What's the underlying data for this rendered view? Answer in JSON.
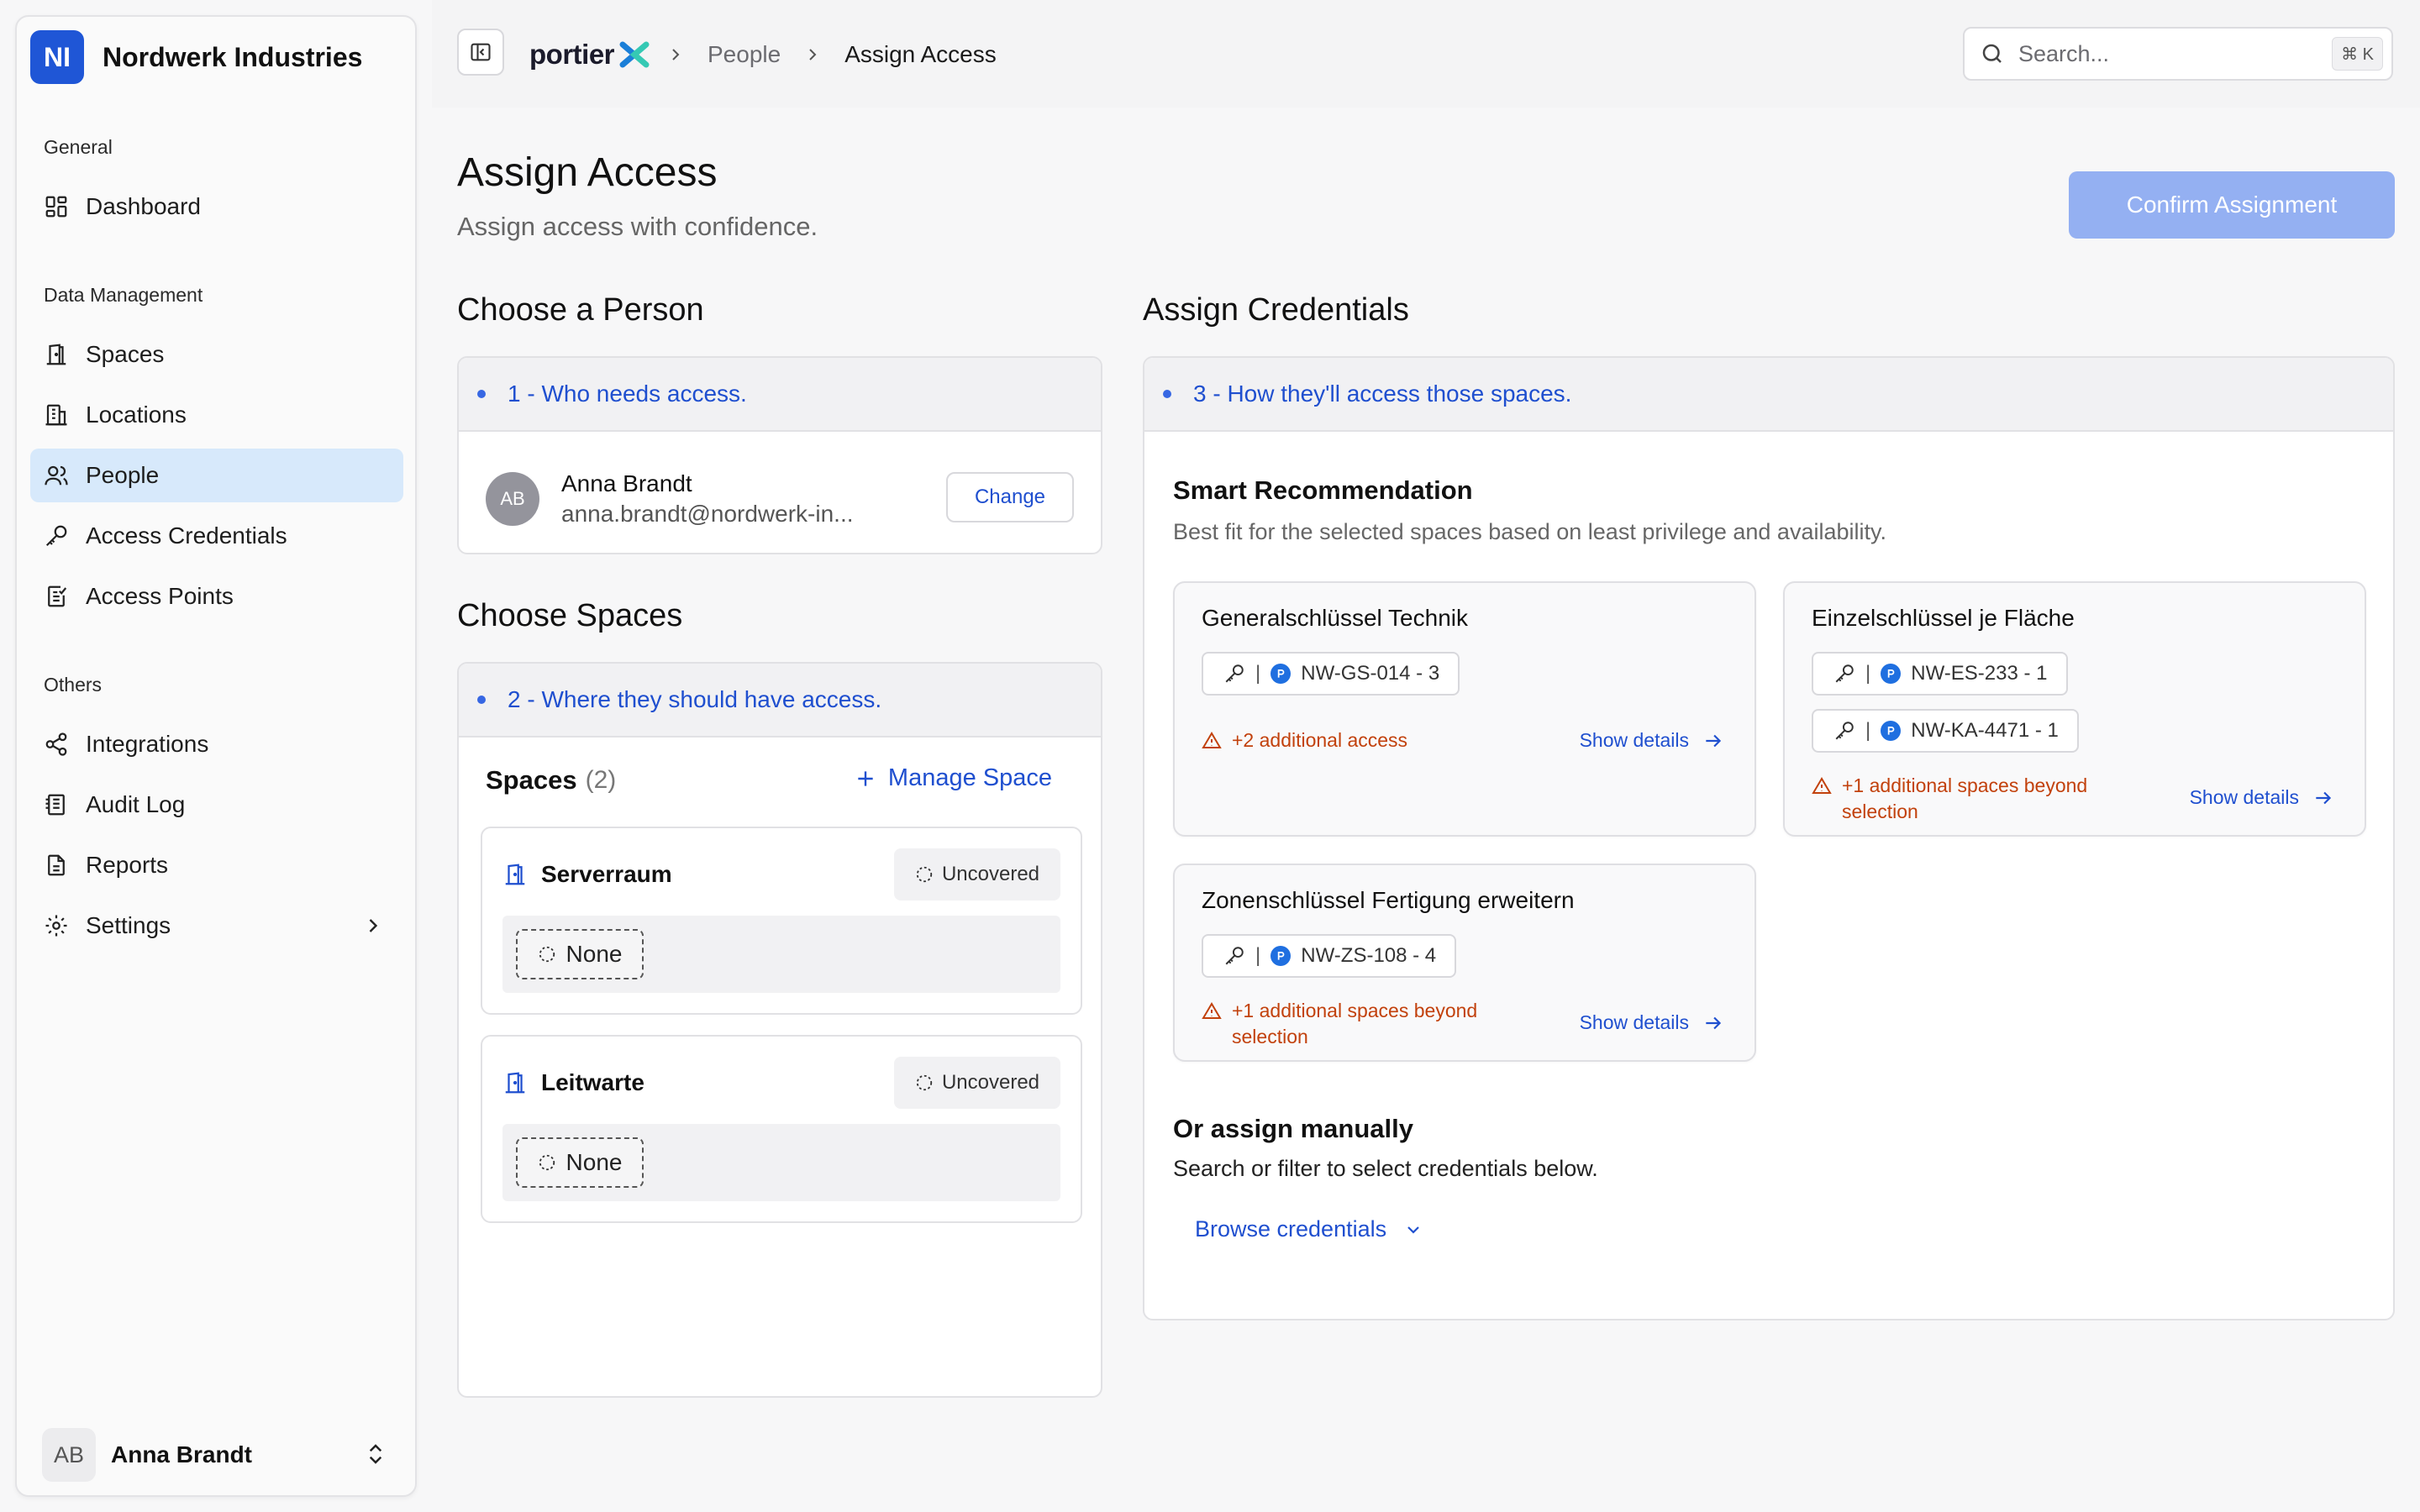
{
  "org": {
    "initials": "NI",
    "name": "Nordwerk Industries"
  },
  "sidebar": {
    "groups": [
      {
        "title": "General",
        "items": [
          {
            "label": "Dashboard",
            "icon": "dashboard-icon"
          }
        ]
      },
      {
        "title": "Data Management",
        "items": [
          {
            "label": "Spaces",
            "icon": "door-icon"
          },
          {
            "label": "Locations",
            "icon": "building-icon"
          },
          {
            "label": "People",
            "icon": "people-icon",
            "active": true
          },
          {
            "label": "Access Credentials",
            "icon": "key-icon"
          },
          {
            "label": "Access Points",
            "icon": "access-point-icon"
          }
        ]
      },
      {
        "title": "Others",
        "items": [
          {
            "label": "Integrations",
            "icon": "share-icon"
          },
          {
            "label": "Audit Log",
            "icon": "log-icon"
          },
          {
            "label": "Reports",
            "icon": "report-icon"
          },
          {
            "label": "Settings",
            "icon": "gear-icon"
          }
        ]
      }
    ],
    "user": {
      "initials": "AB",
      "name": "Anna Brandt"
    }
  },
  "topbar": {
    "brand": "portier",
    "breadcrumbs": [
      "People",
      "Assign Access"
    ],
    "search_placeholder": "Search...",
    "shortcut": "⌘ K"
  },
  "page": {
    "title": "Assign Access",
    "subtitle": "Assign access with confidence.",
    "confirm_label": "Confirm Assignment"
  },
  "person_section": {
    "title": "Choose a Person",
    "step": "1 - Who needs access.",
    "person": {
      "initials": "AB",
      "name": "Anna Brandt",
      "email": "anna.brandt@nordwerk-in..."
    },
    "change_label": "Change"
  },
  "spaces_section": {
    "title": "Choose Spaces",
    "step": "2 - Where they should have access.",
    "list_title": "Spaces",
    "count": "(2)",
    "manage_label": "Manage Space",
    "spaces": [
      {
        "name": "Serverraum",
        "status": "Uncovered",
        "credential": "None"
      },
      {
        "name": "Leitwarte",
        "status": "Uncovered",
        "credential": "None"
      }
    ]
  },
  "credentials_section": {
    "title": "Assign Credentials",
    "step": "3 - How they'll access those spaces.",
    "smart_title": "Smart Recommendation",
    "smart_subtitle": "Best fit for the selected spaces based on least privilege and availability.",
    "recommendations": [
      {
        "title": "Generalschlüssel Technik",
        "chips": [
          "NW-GS-014 - 3"
        ],
        "warning": "+2 additional access",
        "details_label": "Show details"
      },
      {
        "title": "Einzelschlüssel je Fläche",
        "chips": [
          "NW-ES-233 - 1",
          "NW-KA-4471 - 1"
        ],
        "warning": "+1 additional spaces beyond selection",
        "details_label": "Show details"
      },
      {
        "title": "Zonenschlüssel Fertigung erweitern",
        "chips": [
          "NW-ZS-108 - 4"
        ],
        "warning": "+1 additional spaces beyond selection",
        "details_label": "Show details"
      }
    ],
    "manual_title": "Or assign manually",
    "manual_subtitle": "Search or filter to select credentials below.",
    "browse_label": "Browse credentials"
  },
  "colors": {
    "accent": "#1f4fcf",
    "brand_blue": "#1f56d6",
    "warning": "#c2410c",
    "confirm_disabled": "#94b0f2",
    "nav_active": "#d7e9fb"
  }
}
